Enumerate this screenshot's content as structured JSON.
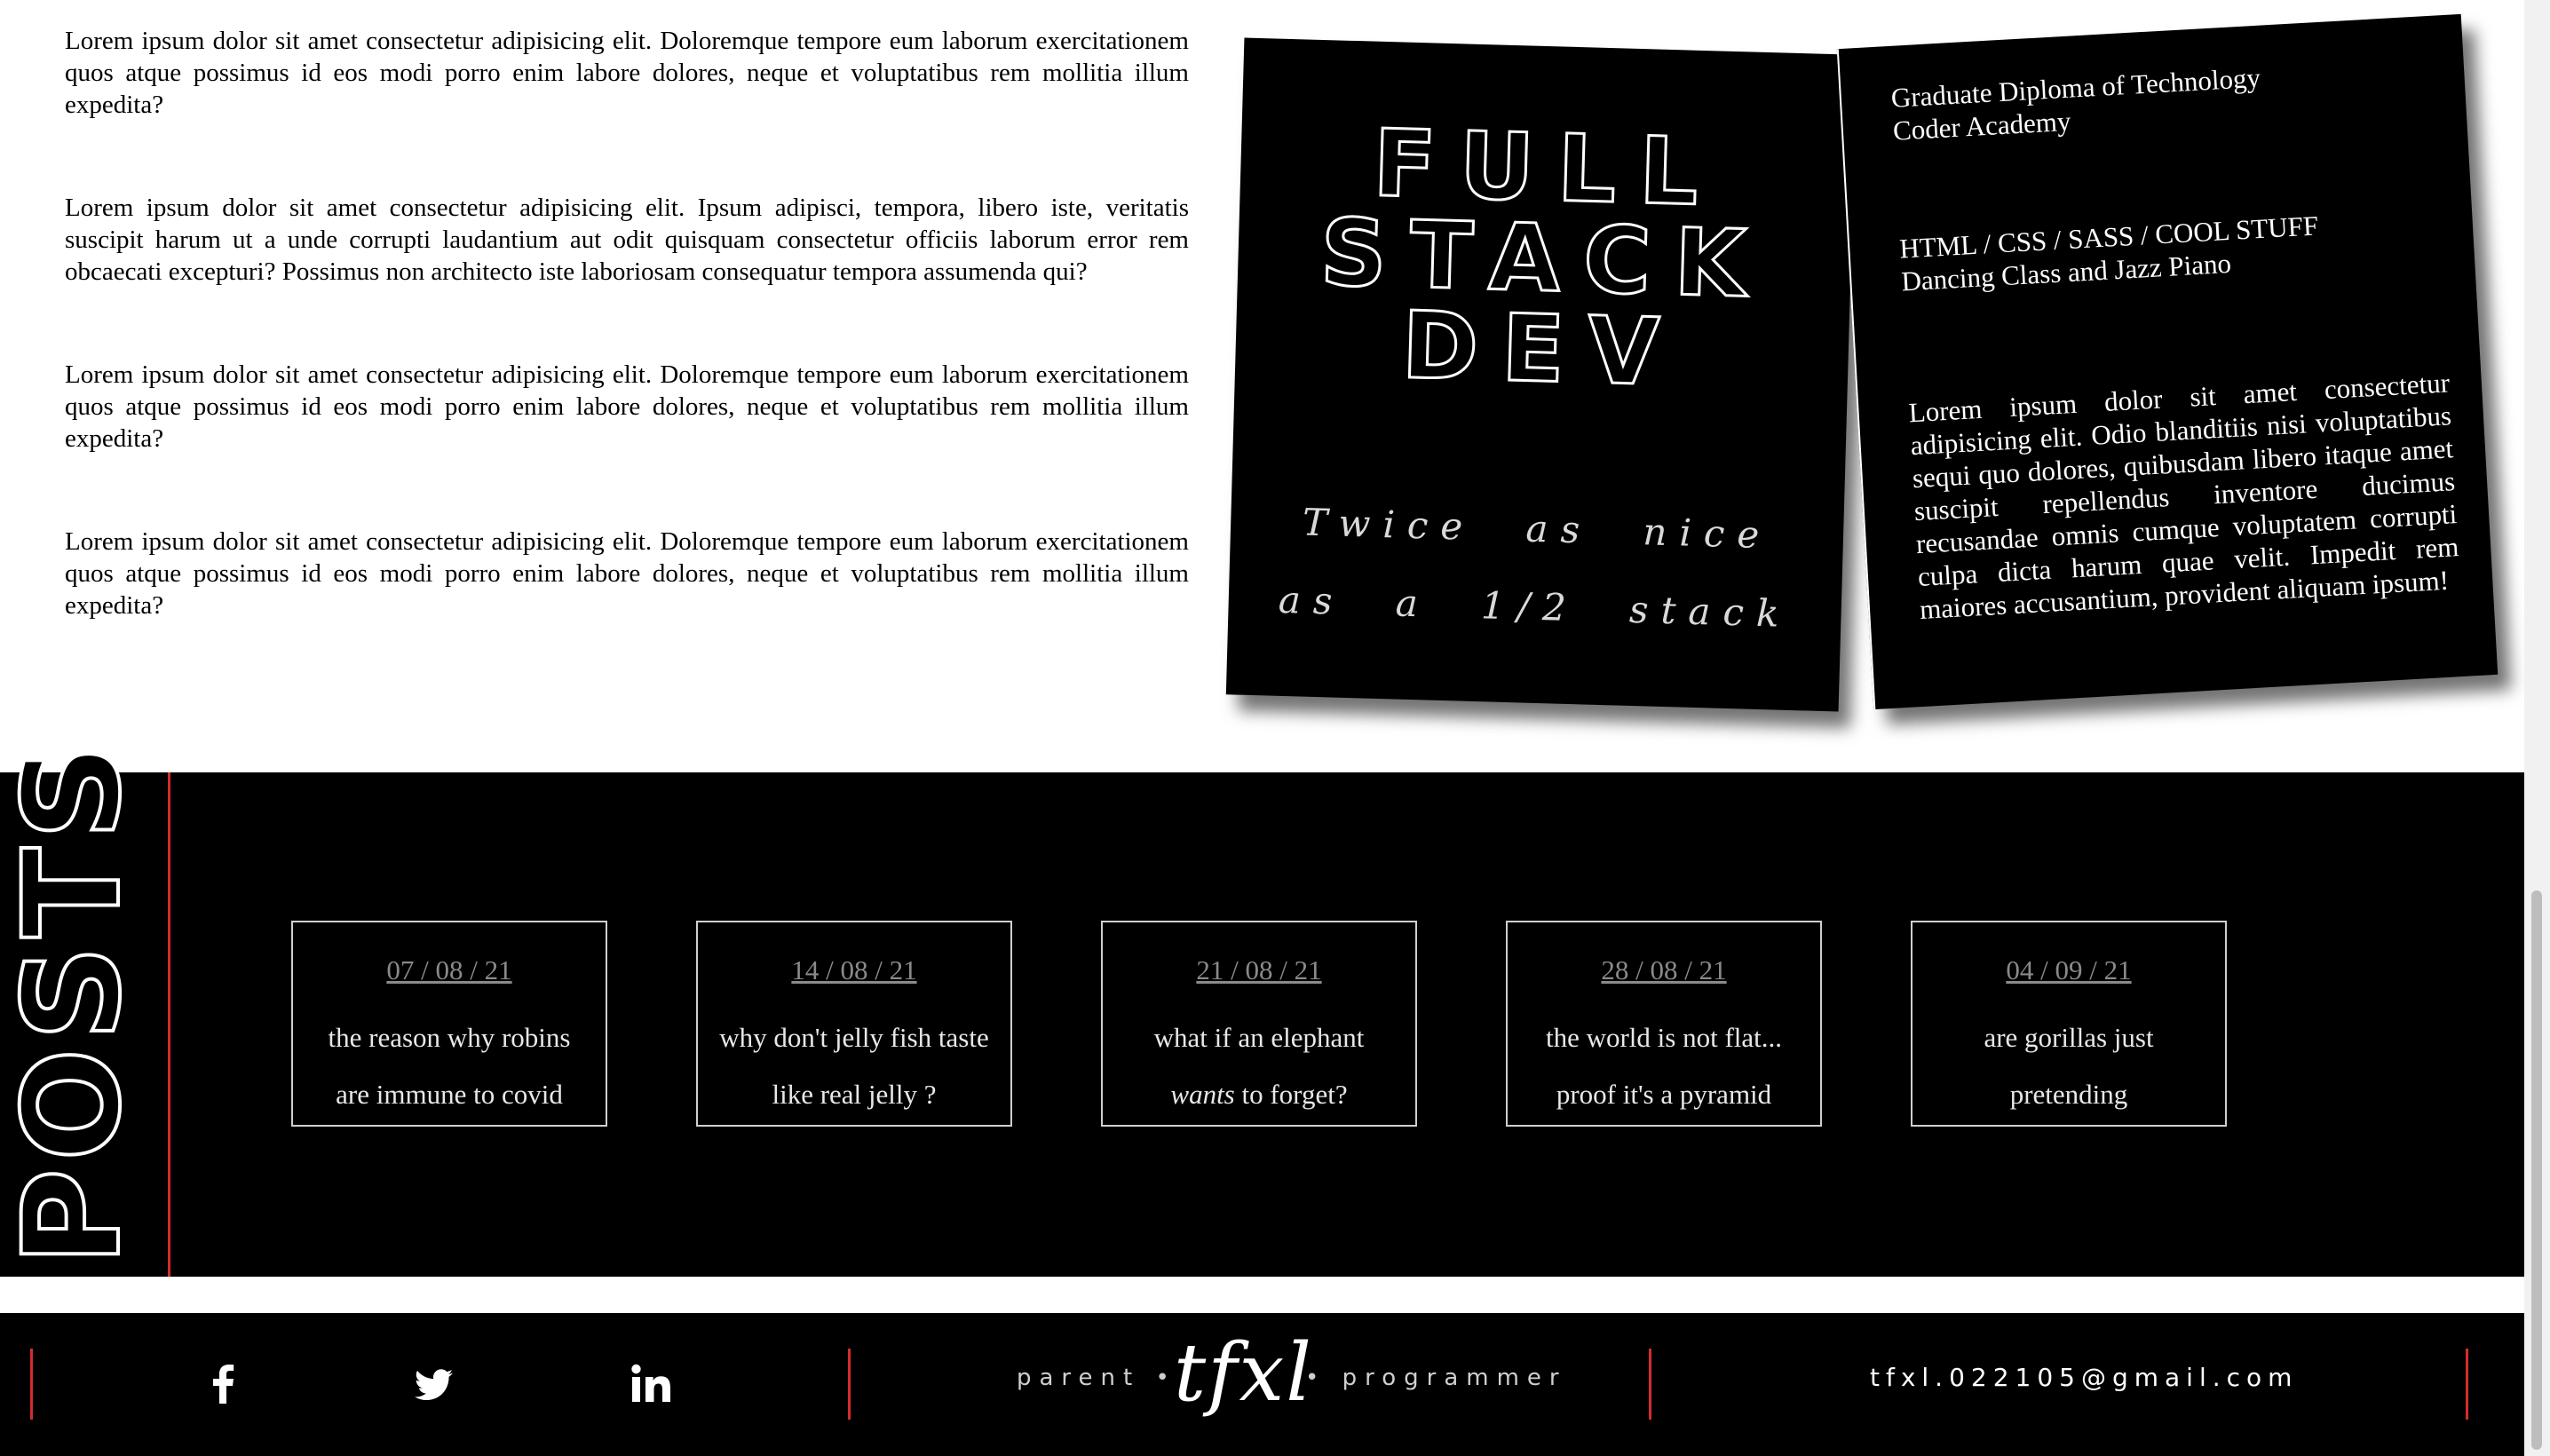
{
  "intro": {
    "paragraphs": [
      "Lorem ipsum dolor sit amet consectetur adipisicing elit. Doloremque tempore eum laborum exercitationem quos atque possimus id eos modi porro enim labore dolores, neque et voluptatibus rem mollitia illum expedita?",
      "Lorem ipsum dolor sit amet consectetur adipisicing elit. Ipsum adipisci, tempora, libero iste, veritatis suscipit harum ut a unde corrupti laudantium aut odit quisquam consectetur officiis laborum error rem obcaecati excepturi? Possimus non architecto iste laboriosam consequatur tempora assumenda qui?",
      "Lorem ipsum dolor sit amet consectetur adipisicing elit. Doloremque tempore eum laborum exercitationem quos atque possimus id eos modi porro enim labore dolores, neque et voluptatibus rem mollitia illum expedita?",
      "Lorem ipsum dolor sit amet consectetur adipisicing elit. Doloremque tempore eum laborum exercitationem quos atque possimus id eos modi porro enim labore dolores, neque et voluptatibus rem mollitia illum expedita?"
    ]
  },
  "logo_card": {
    "title_lines": [
      "FULL",
      "STACK",
      "DEV"
    ],
    "tagline_lines": [
      "Twice as nice",
      "as a 1/2 stack"
    ]
  },
  "cv_card": {
    "education": [
      "Graduate Diploma of Technology",
      "Coder Academy"
    ],
    "skills": [
      "HTML / CSS / SASS / COOL STUFF",
      "Dancing Class and Jazz Piano"
    ],
    "blurb": "Lorem ipsum dolor sit amet consectetur adipisicing elit. Odio blanditiis nisi voluptatibus sequi quo dolores, quibusdam libero itaque amet suscipit repellendus inventore ducimus recusandae omnis cumque voluptatem corrupti culpa dicta harum quae velit. Impedit rem maiores accusantium, provident aliquam ipsum!"
  },
  "posts": {
    "heading": "POSTS",
    "items": [
      {
        "date": "07 / 08 / 21",
        "line1": "the reason why robins",
        "line2": "are immune to covid"
      },
      {
        "date": "14 / 08 / 21",
        "line1": "why don't jelly fish taste",
        "line2": "like real jelly ?"
      },
      {
        "date": "21 / 08 / 21",
        "line1": "what if an elephant",
        "line2_em": "wants",
        "line2_rest": " to forget?"
      },
      {
        "date": "28 / 08 / 21",
        "line1": "the world is not flat...",
        "line2": "proof it's a pyramid"
      },
      {
        "date": "04 / 09 / 21",
        "line1": "are gorillas just",
        "line2": "pretending"
      }
    ]
  },
  "footer": {
    "social": [
      "facebook-icon",
      "twitter-icon",
      "linkedin-icon"
    ],
    "left_text": "parent •",
    "brand": "tfxl",
    "right_text": "• programmer",
    "email": "tfxl.022105@gmail.com",
    "accent_color": "#d42c2c"
  }
}
